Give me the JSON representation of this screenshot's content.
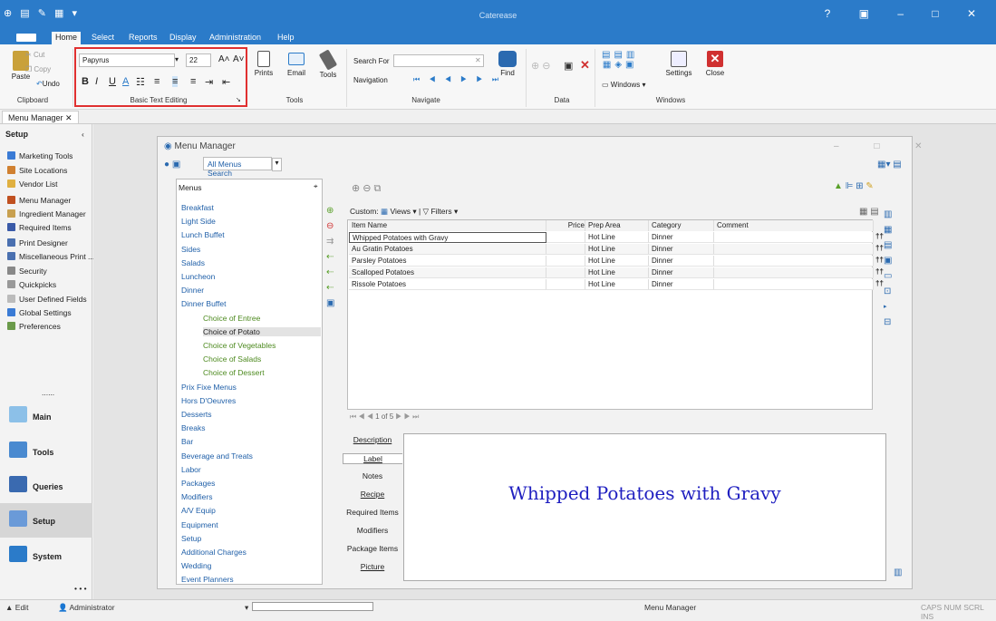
{
  "app": {
    "title": "Caterease"
  },
  "menubar": {
    "tabs": [
      "Home",
      "Select",
      "Reports",
      "Display",
      "Administration",
      "Help"
    ]
  },
  "ribbon": {
    "cut": "Cut",
    "copy": "Copy",
    "paste": "Paste",
    "undo": "Undo",
    "font_name": "Papyrus",
    "font_size": "22",
    "prints": "Prints",
    "email": "Email",
    "tools": "Tools",
    "search_for": "Search For",
    "navigation": "Navigation",
    "find": "Find",
    "settings": "Settings",
    "close": "Close",
    "windows": "Windows",
    "groups": {
      "clipboard": "Clipboard",
      "basic_text": "Basic Text Editing",
      "tools": "Tools",
      "navigate": "Navigate",
      "data": "Data",
      "windows": "Windows"
    }
  },
  "doc_tab": "Menu Manager ✕",
  "sidebar": {
    "header": "Setup",
    "items": [
      "Marketing Tools",
      "Site Locations",
      "Vendor List",
      "Menu Manager",
      "Ingredient Manager",
      "Required Items",
      "Print Designer",
      "Miscellaneous Print ...",
      "Security",
      "Quickpicks",
      "User Defined Fields",
      "Global Settings",
      "Preferences"
    ],
    "more": "......",
    "nav": [
      "Main",
      "Tools",
      "Queries",
      "Setup",
      "System"
    ],
    "dots": "• • •"
  },
  "window": {
    "title": "Menu Manager",
    "search_label": "All Menus Search",
    "menus_header": "Menus",
    "tree": [
      {
        "label": "Breakfast",
        "indent": 0,
        "green": false
      },
      {
        "label": "Light Side",
        "indent": 0,
        "green": false
      },
      {
        "label": "Lunch Buffet",
        "indent": 0,
        "green": false
      },
      {
        "label": "Sides",
        "indent": 0,
        "green": false
      },
      {
        "label": "Salads",
        "indent": 0,
        "green": false
      },
      {
        "label": "Luncheon",
        "indent": 0,
        "green": false
      },
      {
        "label": "Dinner",
        "indent": 0,
        "green": false
      },
      {
        "label": "Dinner Buffet",
        "indent": 0,
        "green": false
      },
      {
        "label": "Choice of Entree",
        "indent": 1,
        "green": true
      },
      {
        "label": "Choice of Potato",
        "indent": 1,
        "green": false
      },
      {
        "label": "Choice of Vegetables",
        "indent": 1,
        "green": true
      },
      {
        "label": "Choice of Salads",
        "indent": 1,
        "green": true
      },
      {
        "label": "Choice of Dessert",
        "indent": 1,
        "green": true
      },
      {
        "label": "Prix Fixe Menus",
        "indent": 0,
        "green": false
      },
      {
        "label": "Hors D'Oeuvres",
        "indent": 0,
        "green": false
      },
      {
        "label": "Desserts",
        "indent": 0,
        "green": false
      },
      {
        "label": "Breaks",
        "indent": 0,
        "green": false
      },
      {
        "label": "Bar",
        "indent": 0,
        "green": false
      },
      {
        "label": "Beverage and Treats",
        "indent": 0,
        "green": false
      },
      {
        "label": "Labor",
        "indent": 0,
        "green": false
      },
      {
        "label": "Packages",
        "indent": 0,
        "green": false
      },
      {
        "label": "Modifiers",
        "indent": 0,
        "green": false
      },
      {
        "label": "A/V Equip",
        "indent": 0,
        "green": false
      },
      {
        "label": "Equipment",
        "indent": 0,
        "green": false
      },
      {
        "label": "Setup",
        "indent": 0,
        "green": false
      },
      {
        "label": "Additional Charges",
        "indent": 0,
        "green": false
      },
      {
        "label": "Wedding",
        "indent": 0,
        "green": false
      },
      {
        "label": "Event Planners",
        "indent": 0,
        "green": false
      }
    ],
    "custom": "Custom:",
    "views": "Views",
    "filters": "Filters",
    "columns": [
      "Item Name",
      "Price",
      "Prep Area",
      "Category",
      "Comment"
    ],
    "rows": [
      [
        "Whipped Potatoes with Gravy",
        "",
        "Hot Line",
        "Dinner",
        ""
      ],
      [
        "Au Gratin Potatoes",
        "",
        "Hot Line",
        "Dinner",
        ""
      ],
      [
        "Parsley Potatoes",
        "",
        "Hot Line",
        "Dinner",
        ""
      ],
      [
        "Scalloped Potatoes",
        "",
        "Hot Line",
        "Dinner",
        ""
      ],
      [
        "Rissole Potatoes",
        "",
        "Hot Line",
        "Dinner",
        ""
      ]
    ],
    "pager": "1 of 5",
    "detail_tabs": [
      "Description",
      "Label",
      "Notes",
      "Recipe",
      "Required Items",
      "Modifiers",
      "Package Items",
      "Picture"
    ],
    "preview_text": "Whipped Potatoes with Gravy"
  },
  "status": {
    "edit": "Edit",
    "user": "Administrator",
    "screen": "Menu Manager",
    "keys": "CAPS NUM SCRL INS"
  }
}
